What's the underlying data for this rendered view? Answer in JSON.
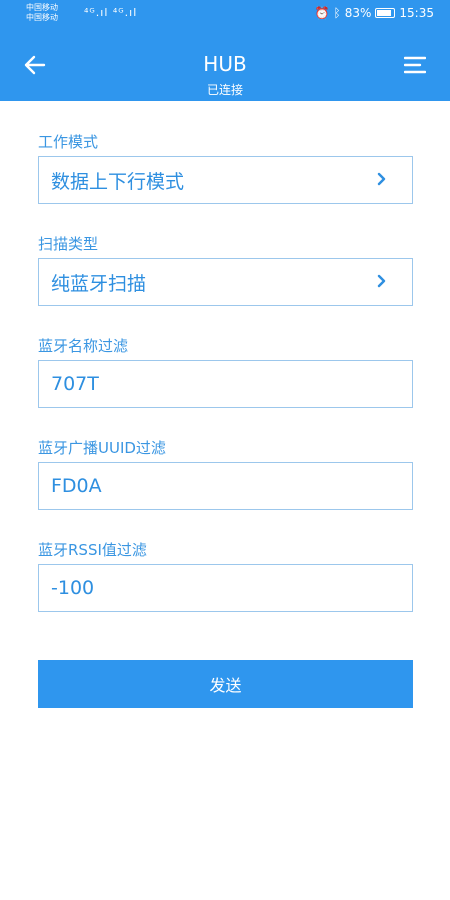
{
  "status_bar": {
    "carrier1": "中国移动",
    "carrier2": "中国移动",
    "signal": "⁴ᴳ.ıl ⁴ᴳ.ıl",
    "battery": "83%",
    "time": "15:35"
  },
  "header": {
    "title": "HUB",
    "subtitle": "已连接",
    "back_icon": "arrow-left-icon",
    "menu_icon": "menu-icon",
    "color": "#2f96ee"
  },
  "form": {
    "work_mode": {
      "label": "工作模式",
      "value": "数据上下行模式"
    },
    "scan_type": {
      "label": "扫描类型",
      "value": "纯蓝牙扫描"
    },
    "name_filter": {
      "label": "蓝牙名称过滤",
      "value": "707T"
    },
    "uuid_filter": {
      "label": "蓝牙广播UUID过滤",
      "value": "FD0A"
    },
    "rssi_filter": {
      "label": "蓝牙RSSI值过滤",
      "value": "-100"
    }
  },
  "actions": {
    "send_label": "发送"
  }
}
